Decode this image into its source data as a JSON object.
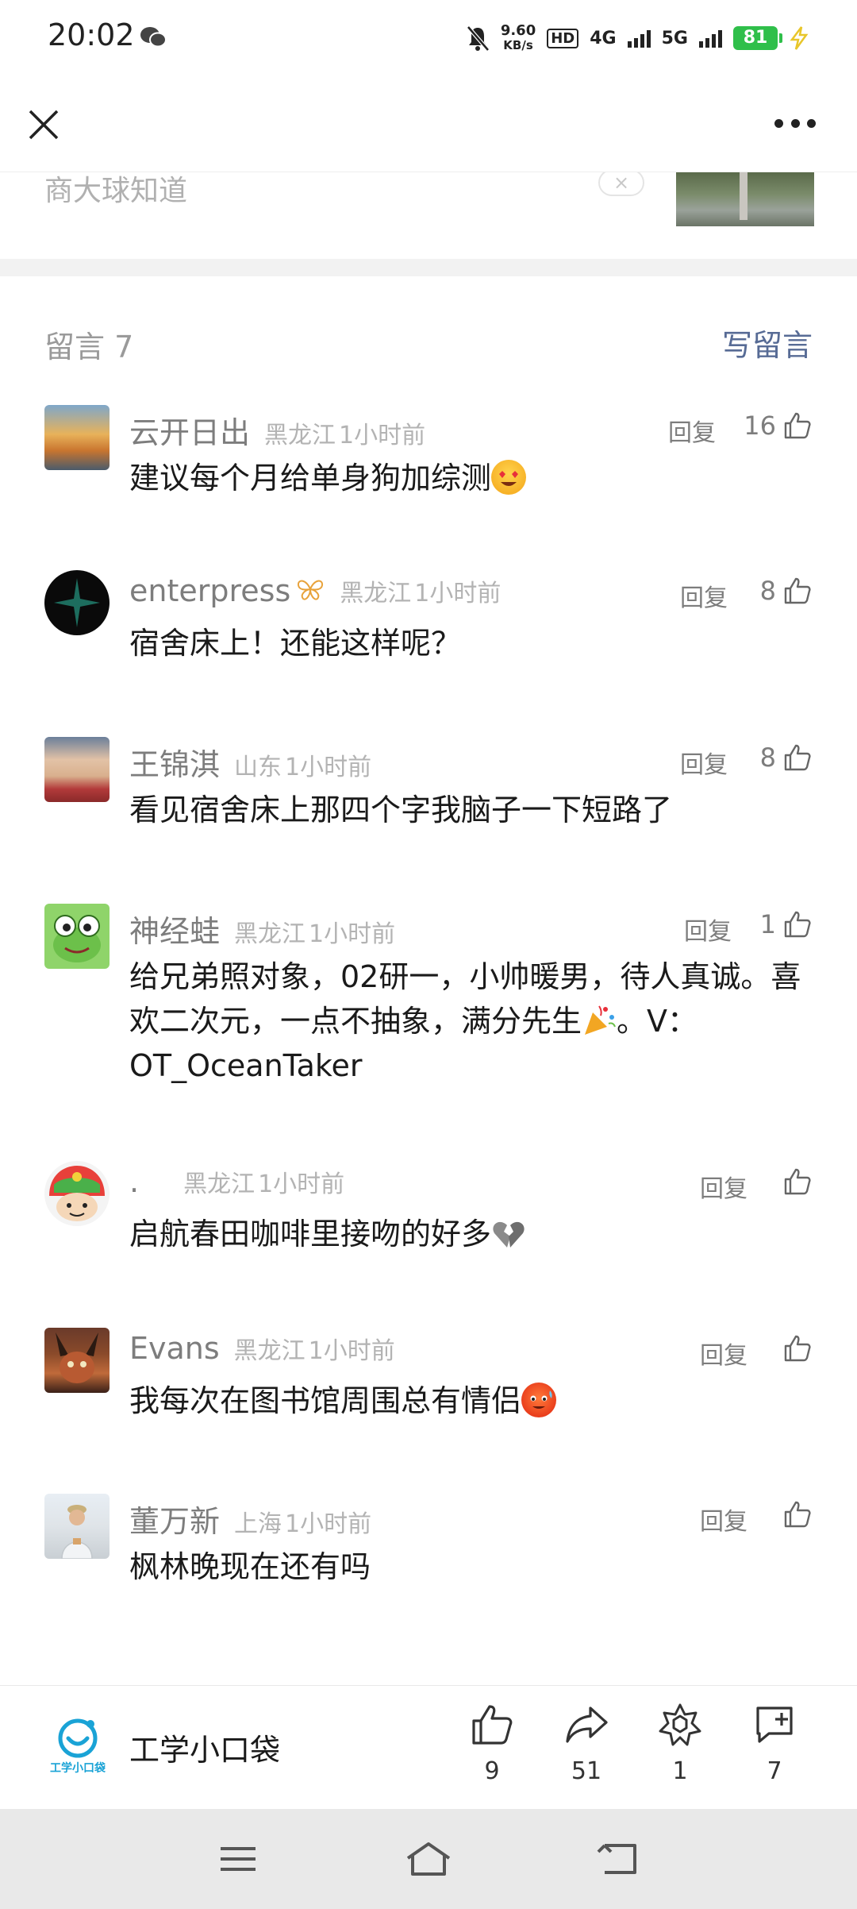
{
  "status_bar": {
    "time": "20:02",
    "net_speed_value": "9.60",
    "net_speed_unit": "KB/s",
    "hd_label": "HD",
    "net_1": "4G",
    "net_2": "5G",
    "battery": "81",
    "battery_color": "#2fbf4a"
  },
  "top_card": {
    "text": "商大球知道",
    "close_symbol": "×"
  },
  "comments": {
    "title": "留言 7",
    "write_label": "写留言",
    "accent_color": "#576b95",
    "reply_label": "回复",
    "items": [
      {
        "name": "云开日出",
        "location": "黑龙江",
        "time": "1小时前",
        "likes": "16",
        "text": "建议每个月给单身狗加综测",
        "emoji": "heart-eyes-emoji"
      },
      {
        "name": "enterpress",
        "location": "黑龙江",
        "time": "1小时前",
        "likes": "8",
        "text": "宿舍床上！还能这样呢？",
        "badge": "butterfly-badge-icon"
      },
      {
        "name": "王锦淇",
        "location": "山东",
        "time": "1小时前",
        "likes": "8",
        "text": "看见宿舍床上那四个字我脑子一下短路了"
      },
      {
        "name": "神经蛙",
        "location": "黑龙江",
        "time": "1小时前",
        "likes": "1",
        "text_1": "给兄弟照对象，02研一，小帅暖男，待人真诚。喜欢二次元，一点不抽象，满分先生",
        "text_2": "。V：OT_OceanTaker",
        "emoji": "party-popper-emoji"
      },
      {
        "name": ".",
        "location": "黑龙江",
        "time": "1小时前",
        "likes": "",
        "text": "启航春田咖啡里接吻的好多",
        "emoji": "broken-heart-emoji"
      },
      {
        "name": "Evans",
        "location": "黑龙江",
        "time": "1小时前",
        "likes": "",
        "text": "我每次在图书馆周围总有情侣",
        "emoji": "hot-face-emoji"
      },
      {
        "name": "董万新",
        "location": "上海",
        "time": "1小时前",
        "likes": "",
        "text": "枫林晚现在还有吗"
      }
    ]
  },
  "bottom_bar": {
    "account_name": "工学小口袋",
    "logo_text": "工学小口袋",
    "like_count": "9",
    "share_count": "51",
    "recommend_count": "1",
    "comment_count": "7",
    "brand_color": "#1aa3d6"
  }
}
